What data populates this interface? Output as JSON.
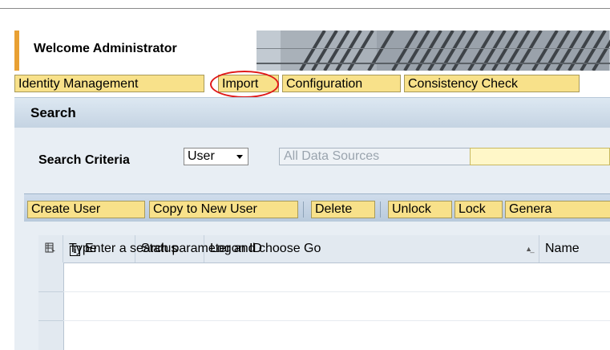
{
  "header": {
    "title": "Welcome Administrator",
    "accent_color": "#e8a033"
  },
  "tabs": [
    {
      "label": "Identity Management"
    },
    {
      "label": "Import",
      "highlighted": true
    },
    {
      "label": "Configuration"
    },
    {
      "label": "Consistency Check"
    }
  ],
  "section": {
    "title": "Search"
  },
  "search": {
    "criteria_label": "Search Criteria",
    "type_value": "User",
    "datasource_placeholder": "All Data Sources",
    "field_value": ""
  },
  "toolbar": {
    "buttons": [
      {
        "label": "Create User"
      },
      {
        "label": "Copy to New User"
      },
      {
        "label": "Delete"
      },
      {
        "label": "Unlock"
      },
      {
        "label": "Lock"
      },
      {
        "label": "Genera"
      }
    ]
  },
  "table": {
    "columns": [
      "Type",
      "Status",
      "Logon ID",
      "Name"
    ],
    "empty_message": "Enter a search parameter and choose Go"
  },
  "icons": {
    "select_all": "table-settings-icon",
    "info": "info-icon",
    "sort": "sort-icon",
    "dropdown": "chevron-down-icon"
  }
}
